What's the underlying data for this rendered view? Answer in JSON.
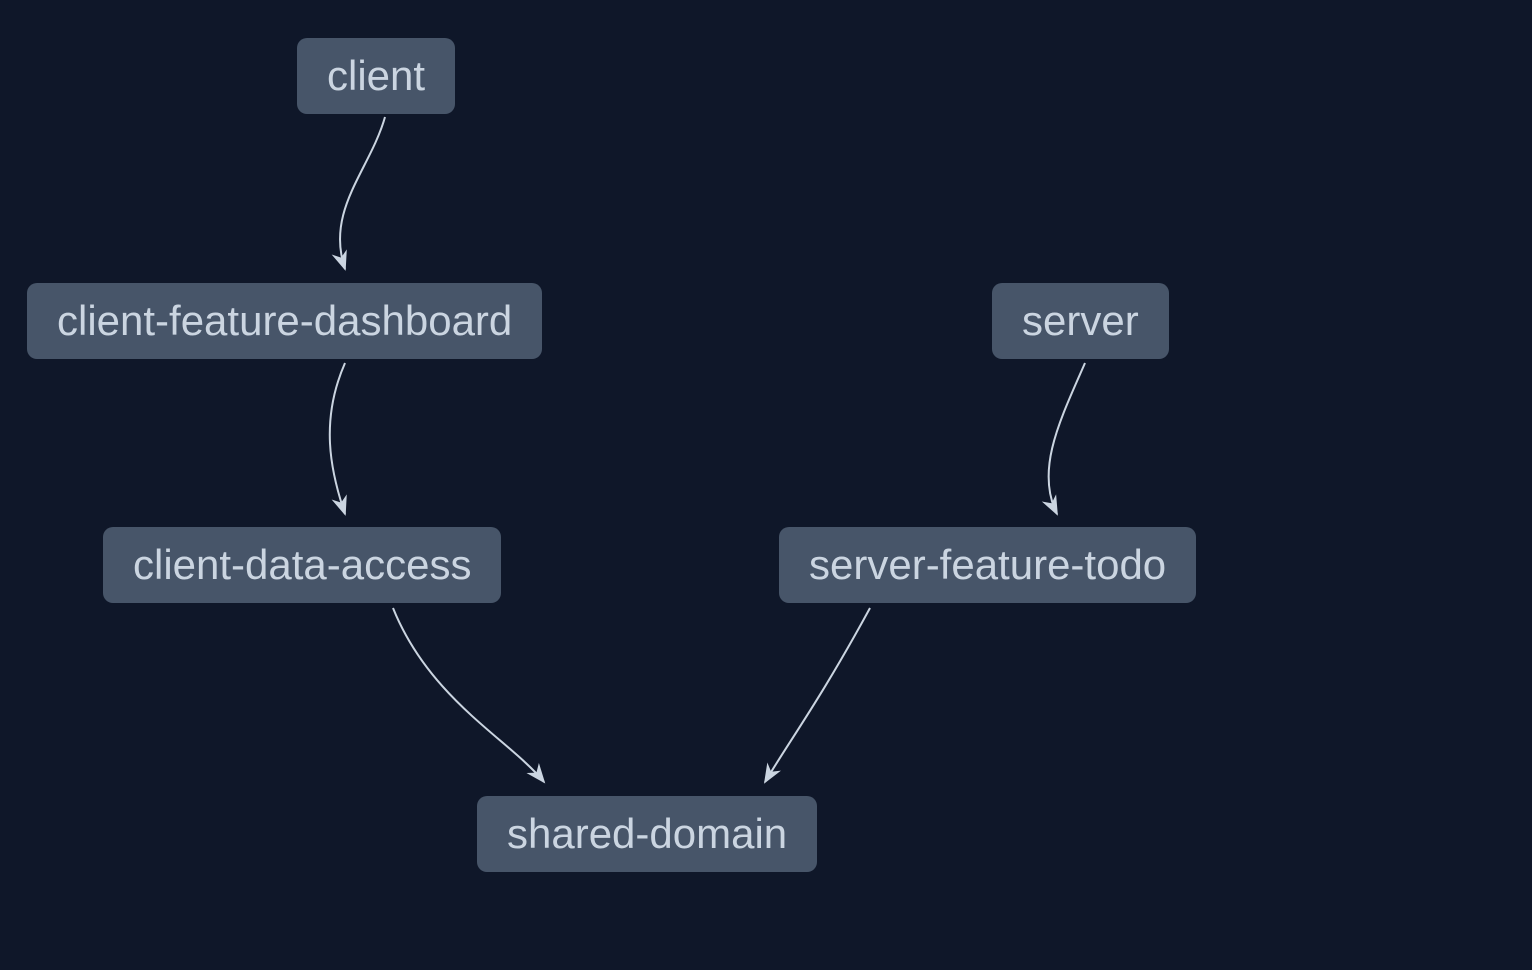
{
  "diagram": {
    "type": "dependency-graph",
    "background_color": "#0f1729",
    "node_fill_color": "#475569",
    "node_text_color": "#cbd5e1",
    "edge_color": "#cbd5e1",
    "nodes": {
      "client": {
        "label": "client"
      },
      "client_feature_dashboard": {
        "label": "client-feature-dashboard"
      },
      "client_data_access": {
        "label": "client-data-access"
      },
      "server": {
        "label": "server"
      },
      "server_feature_todo": {
        "label": "server-feature-todo"
      },
      "shared_domain": {
        "label": "shared-domain"
      }
    },
    "edges": [
      {
        "from": "client",
        "to": "client_feature_dashboard"
      },
      {
        "from": "client_feature_dashboard",
        "to": "client_data_access"
      },
      {
        "from": "client_data_access",
        "to": "shared_domain"
      },
      {
        "from": "server",
        "to": "server_feature_todo"
      },
      {
        "from": "server_feature_todo",
        "to": "shared_domain"
      }
    ]
  }
}
